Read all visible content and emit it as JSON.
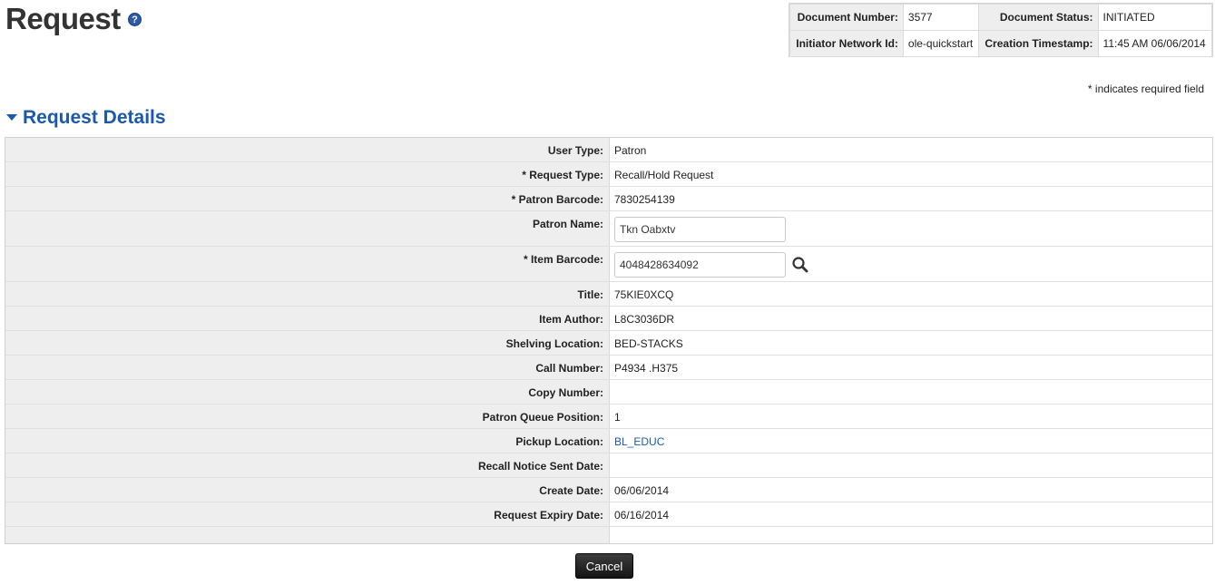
{
  "page": {
    "title": "Request",
    "help_glyph": "?"
  },
  "header": {
    "document_number_label": "Document Number:",
    "document_number": "3577",
    "document_status_label": "Document Status:",
    "document_status": "INITIATED",
    "initiator_label": "Initiator Network Id:",
    "initiator": "ole-quickstart",
    "creation_label": "Creation Timestamp:",
    "creation": "11:45 AM 06/06/2014"
  },
  "required_note": "* indicates required field",
  "section": {
    "title": "Request Details"
  },
  "fields": {
    "user_type_label": "User Type:",
    "user_type": "Patron",
    "request_type_label": "* Request Type:",
    "request_type": "Recall/Hold Request",
    "patron_barcode_label": "* Patron Barcode:",
    "patron_barcode": "7830254139",
    "patron_name_label": "Patron Name:",
    "patron_name": "Tkn Oabxtv",
    "item_barcode_label": "* Item Barcode:",
    "item_barcode": "4048428634092",
    "title_label": "Title:",
    "title": "75KIE0XCQ",
    "item_author_label": "Item Author:",
    "item_author": "L8C3036DR",
    "shelving_location_label": "Shelving Location:",
    "shelving_location": "BED-STACKS",
    "call_number_label": "Call Number:",
    "call_number": "P4934 .H375",
    "copy_number_label": "Copy Number:",
    "copy_number": "",
    "queue_position_label": "Patron Queue Position:",
    "queue_position": "1",
    "pickup_location_label": "Pickup Location:",
    "pickup_location": "BL_EDUC",
    "recall_notice_label": "Recall Notice Sent Date:",
    "recall_notice": "",
    "create_date_label": "Create Date:",
    "create_date": "06/06/2014",
    "expiry_date_label": "Request Expiry Date:",
    "expiry_date": "06/16/2014"
  },
  "actions": {
    "cancel_label": "Cancel"
  },
  "colors": {
    "accent": "#1a5aa8",
    "label_bg": "#eeeeee"
  }
}
